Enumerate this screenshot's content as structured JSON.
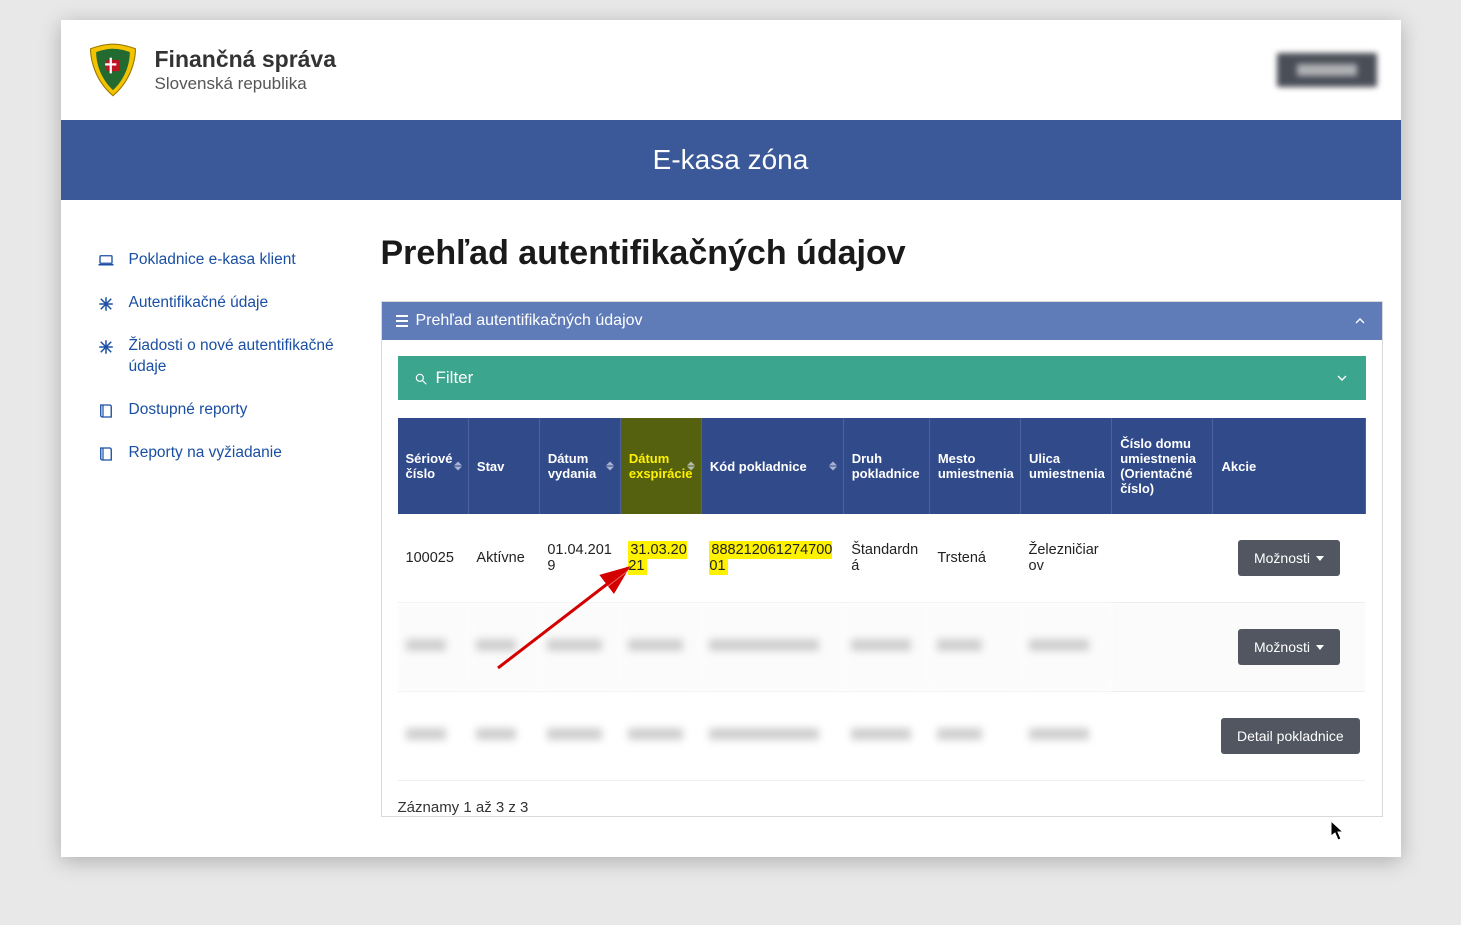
{
  "brand": {
    "title": "Finančná správa",
    "subtitle": "Slovenská republika"
  },
  "banner_title": "E-kasa zóna",
  "sidebar": {
    "items": [
      {
        "label": "Pokladnice e-kasa klient",
        "icon": "laptop"
      },
      {
        "label": "Autentifikačné údaje",
        "icon": "asterisk"
      },
      {
        "label": "Žiadosti o nové autentifikačné údaje",
        "icon": "asterisk"
      },
      {
        "label": "Dostupné reporty",
        "icon": "book"
      },
      {
        "label": "Reporty na vyžiadanie",
        "icon": "book"
      }
    ]
  },
  "main": {
    "heading": "Prehľad autentifikačných údajov",
    "panel_title": "Prehľad autentifikačných údajov",
    "filter_label": "Filter",
    "columns": {
      "serial": "Sériové číslo",
      "stav": "Stav",
      "vydanie": "Dátum vydania",
      "exspiracia": "Dátum exspirácie",
      "kod": "Kód pokladnice",
      "druh": "Druh pokladnice",
      "mesto": "Mesto umiestnenia",
      "ulica": "Ulica umiestnenia",
      "cislo": "Číslo domu umiestnenia (Orientačné číslo)",
      "akcie": "Akcie"
    },
    "rows": [
      {
        "serial": "100025",
        "stav": "Aktívne",
        "vydanie": "01.04.2019",
        "exspiracia": "31.03.2021",
        "kod": "88821206127470001",
        "druh": "Štandardná",
        "mesto": "Trstená",
        "ulica": "Železničiarov",
        "cislo": "",
        "action_label": "Možnosti"
      },
      {
        "action_label": "Možnosti"
      },
      {
        "action_label": "Detail pokladnice"
      }
    ],
    "records_text": "Záznamy 1 až 3 z 3"
  }
}
